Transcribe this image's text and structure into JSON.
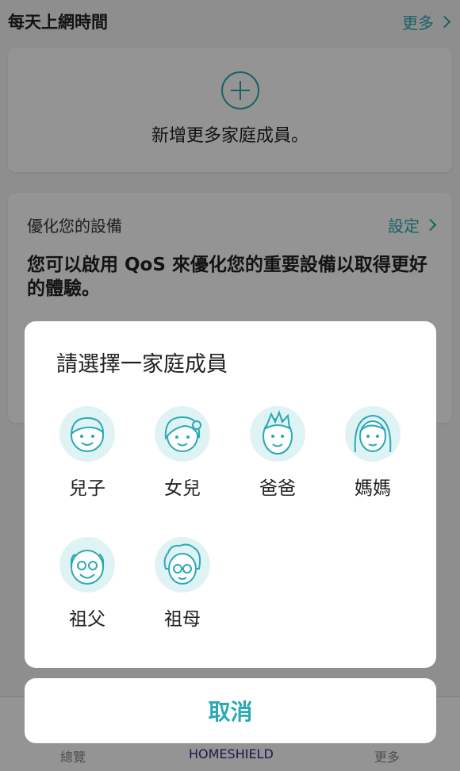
{
  "daily_usage": {
    "title": "每天上網時間",
    "more": "更多"
  },
  "add_member_card": {
    "text": "新增更多家庭成員。"
  },
  "qos_card": {
    "title": "優化您的設備",
    "link": "設定",
    "body": "您可以啟用 QoS 來優化您的重要設備以取得更好的體驗。"
  },
  "tabbar": {
    "overview": "總覽",
    "homeshield": "HOMESHIELD",
    "more": "更多"
  },
  "picker": {
    "title": "請選擇一家庭成員",
    "members": [
      {
        "label": "兒子",
        "icon": "son-avatar-icon"
      },
      {
        "label": "女兒",
        "icon": "daughter-avatar-icon"
      },
      {
        "label": "爸爸",
        "icon": "dad-avatar-icon"
      },
      {
        "label": "媽媽",
        "icon": "mom-avatar-icon"
      },
      {
        "label": "祖父",
        "icon": "grandpa-avatar-icon"
      },
      {
        "label": "祖母",
        "icon": "grandma-avatar-icon"
      }
    ],
    "cancel": "取消"
  },
  "colors": {
    "accent": "#2aa9b5",
    "avatar_bg": "#dff3f5"
  }
}
